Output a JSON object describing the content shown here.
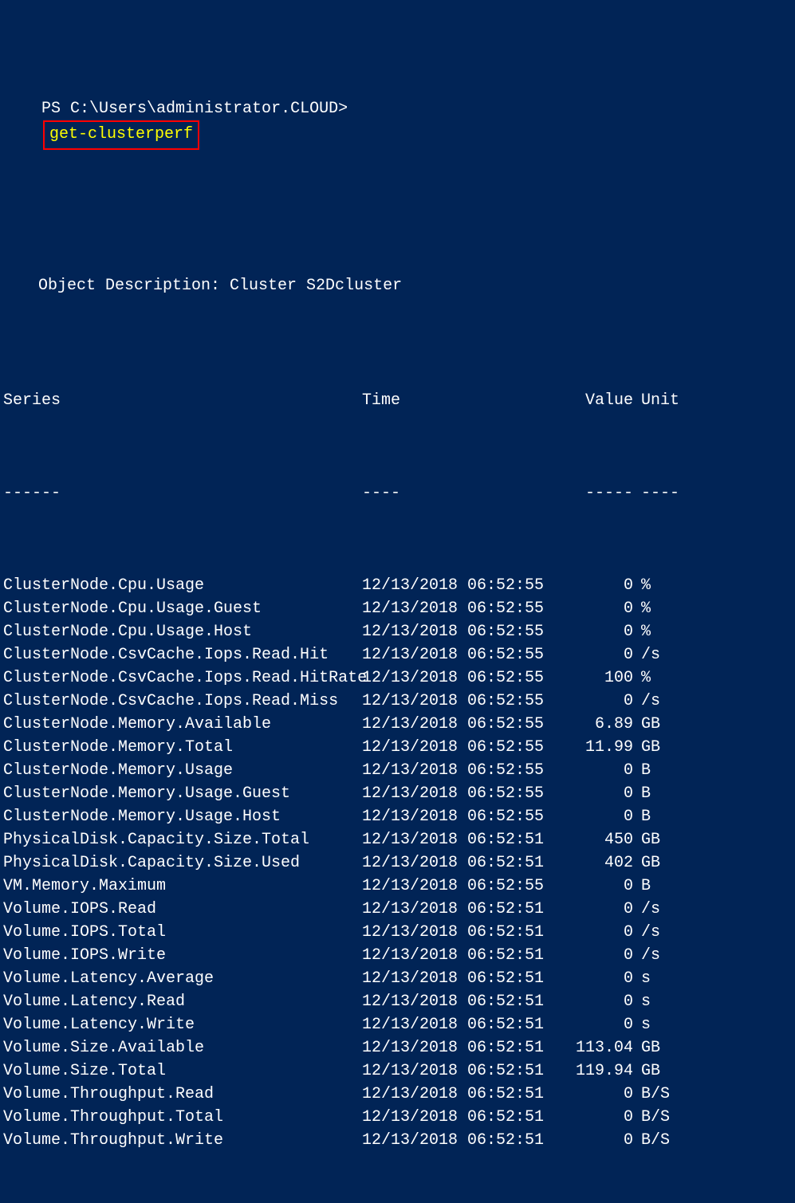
{
  "prompt": "PS C:\\Users\\administrator.CLOUD>",
  "command": "get-clusterperf",
  "description": "Object Description: Cluster S2Dcluster",
  "headers": {
    "series": "Series",
    "time": "Time",
    "value": "Value",
    "unit": "Unit"
  },
  "divider": {
    "series": "------",
    "time": "----",
    "value": "-----",
    "unit": "----"
  },
  "rows": [
    {
      "series": "ClusterNode.Cpu.Usage",
      "time": "12/13/2018 06:52:55",
      "value": "0",
      "unit": "%"
    },
    {
      "series": "ClusterNode.Cpu.Usage.Guest",
      "time": "12/13/2018 06:52:55",
      "value": "0",
      "unit": "%"
    },
    {
      "series": "ClusterNode.Cpu.Usage.Host",
      "time": "12/13/2018 06:52:55",
      "value": "0",
      "unit": "%"
    },
    {
      "series": "ClusterNode.CsvCache.Iops.Read.Hit",
      "time": "12/13/2018 06:52:55",
      "value": "0",
      "unit": "/s"
    },
    {
      "series": "ClusterNode.CsvCache.Iops.Read.HitRate",
      "time": "12/13/2018 06:52:55",
      "value": "100",
      "unit": "%"
    },
    {
      "series": "ClusterNode.CsvCache.Iops.Read.Miss",
      "time": "12/13/2018 06:52:55",
      "value": "0",
      "unit": "/s"
    },
    {
      "series": "ClusterNode.Memory.Available",
      "time": "12/13/2018 06:52:55",
      "value": "6.89",
      "unit": "GB"
    },
    {
      "series": "ClusterNode.Memory.Total",
      "time": "12/13/2018 06:52:55",
      "value": "11.99",
      "unit": "GB"
    },
    {
      "series": "ClusterNode.Memory.Usage",
      "time": "12/13/2018 06:52:55",
      "value": "0",
      "unit": "B"
    },
    {
      "series": "ClusterNode.Memory.Usage.Guest",
      "time": "12/13/2018 06:52:55",
      "value": "0",
      "unit": "B"
    },
    {
      "series": "ClusterNode.Memory.Usage.Host",
      "time": "12/13/2018 06:52:55",
      "value": "0",
      "unit": "B"
    },
    {
      "series": "PhysicalDisk.Capacity.Size.Total",
      "time": "12/13/2018 06:52:51",
      "value": "450",
      "unit": "GB"
    },
    {
      "series": "PhysicalDisk.Capacity.Size.Used",
      "time": "12/13/2018 06:52:51",
      "value": "402",
      "unit": "GB"
    },
    {
      "series": "VM.Memory.Maximum",
      "time": "12/13/2018 06:52:55",
      "value": "0",
      "unit": "B"
    },
    {
      "series": "Volume.IOPS.Read",
      "time": "12/13/2018 06:52:51",
      "value": "0",
      "unit": "/s"
    },
    {
      "series": "Volume.IOPS.Total",
      "time": "12/13/2018 06:52:51",
      "value": "0",
      "unit": "/s"
    },
    {
      "series": "Volume.IOPS.Write",
      "time": "12/13/2018 06:52:51",
      "value": "0",
      "unit": "/s"
    },
    {
      "series": "Volume.Latency.Average",
      "time": "12/13/2018 06:52:51",
      "value": "0",
      "unit": "s"
    },
    {
      "series": "Volume.Latency.Read",
      "time": "12/13/2018 06:52:51",
      "value": "0",
      "unit": "s"
    },
    {
      "series": "Volume.Latency.Write",
      "time": "12/13/2018 06:52:51",
      "value": "0",
      "unit": "s"
    },
    {
      "series": "Volume.Size.Available",
      "time": "12/13/2018 06:52:51",
      "value": "113.04",
      "unit": "GB"
    },
    {
      "series": "Volume.Size.Total",
      "time": "12/13/2018 06:52:51",
      "value": "119.94",
      "unit": "GB"
    },
    {
      "series": "Volume.Throughput.Read",
      "time": "12/13/2018 06:52:51",
      "value": "0",
      "unit": "B/S"
    },
    {
      "series": "Volume.Throughput.Total",
      "time": "12/13/2018 06:52:51",
      "value": "0",
      "unit": "B/S"
    },
    {
      "series": "Volume.Throughput.Write",
      "time": "12/13/2018 06:52:51",
      "value": "0",
      "unit": "B/S"
    }
  ]
}
